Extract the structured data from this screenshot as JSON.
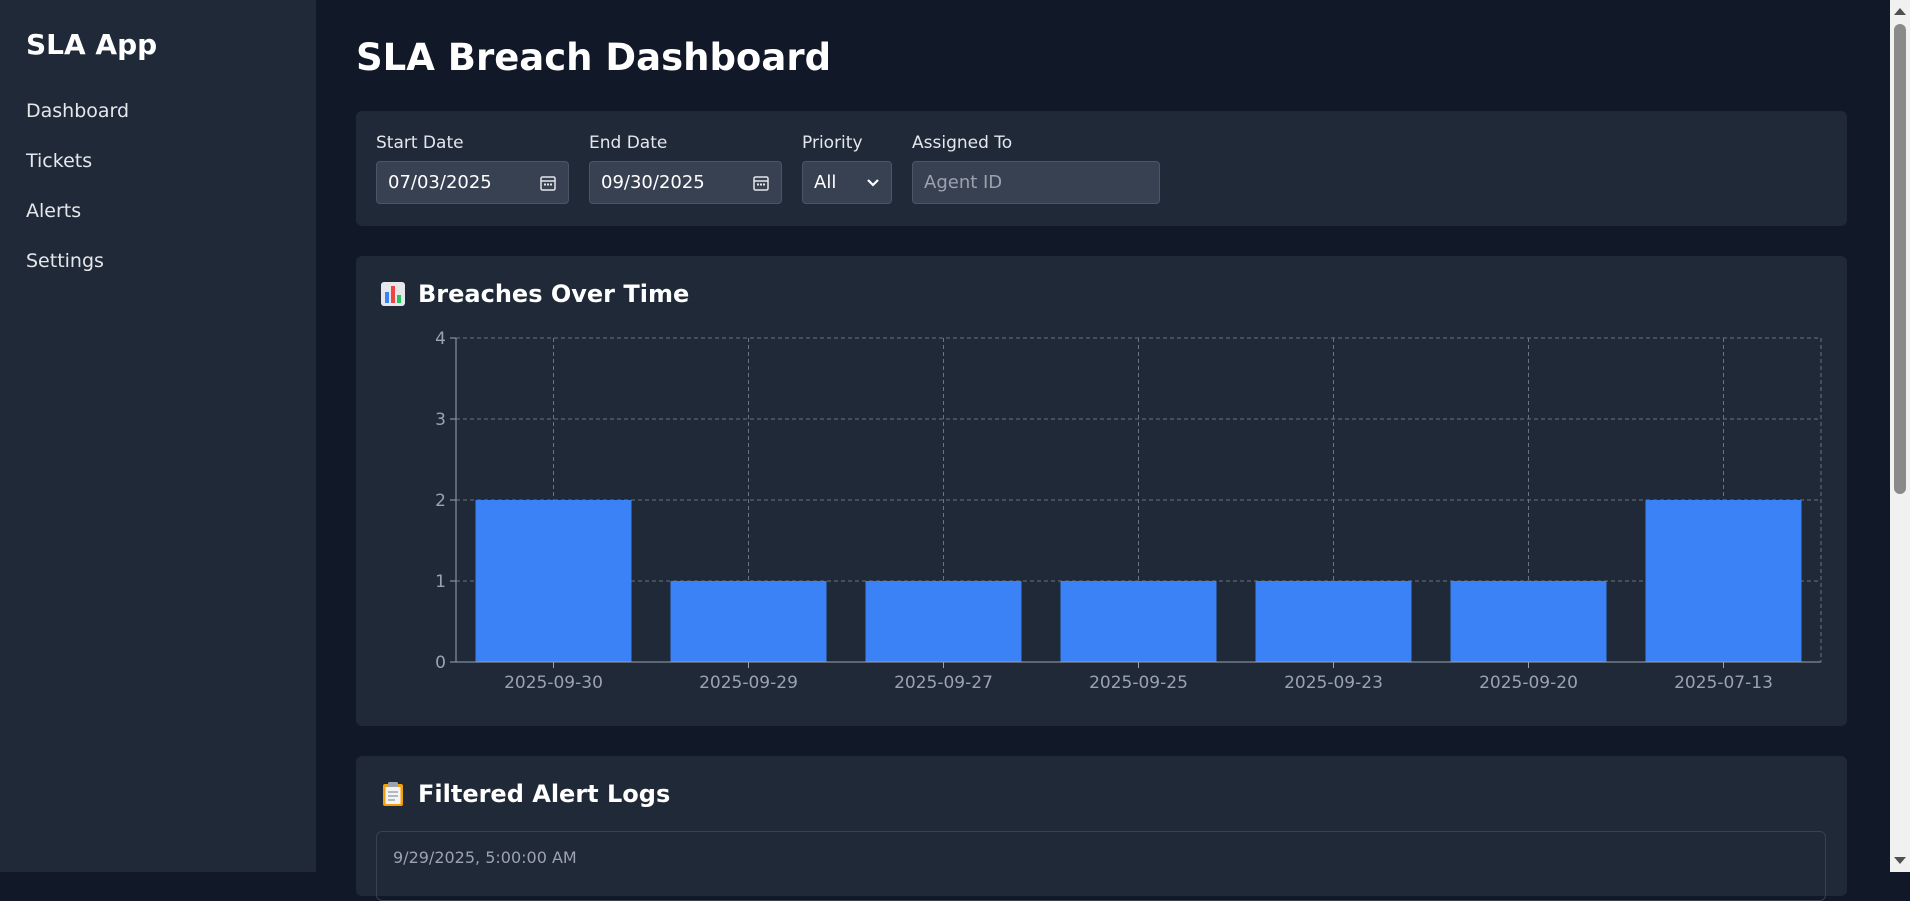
{
  "sidebar": {
    "app_title": "SLA App",
    "items": [
      {
        "label": "Dashboard"
      },
      {
        "label": "Tickets"
      },
      {
        "label": "Alerts"
      },
      {
        "label": "Settings"
      }
    ]
  },
  "page_title": "SLA Breach Dashboard",
  "filters": {
    "start_date": {
      "label": "Start Date",
      "value": "07/03/2025",
      "icon": "calendar-icon"
    },
    "end_date": {
      "label": "End Date",
      "value": "09/30/2025",
      "icon": "calendar-icon"
    },
    "priority": {
      "label": "Priority",
      "value": "All",
      "icon": "chevron-down-icon"
    },
    "assigned_to": {
      "label": "Assigned To",
      "placeholder": "Agent ID"
    }
  },
  "chart_section": {
    "heading": "Breaches Over Time",
    "icon": "bar-chart-icon"
  },
  "chart_data": {
    "type": "bar",
    "categories": [
      "2025-09-30",
      "2025-09-29",
      "2025-09-27",
      "2025-09-25",
      "2025-09-23",
      "2025-09-20",
      "2025-07-13"
    ],
    "values": [
      2,
      1,
      1,
      1,
      1,
      1,
      2
    ],
    "ylim": [
      0,
      4
    ],
    "yticks": [
      0,
      1,
      2,
      3,
      4
    ],
    "grid": true,
    "bar_color": "#3b82f6",
    "grid_color": "#6b7280",
    "tick_color": "#9ca3af"
  },
  "logs_section": {
    "heading": "Filtered Alert Logs",
    "icon": "clipboard-icon",
    "entries": [
      {
        "timestamp": "9/29/2025, 5:00:00 AM"
      }
    ]
  },
  "colors": {
    "background": "#111827",
    "panel": "#1f2937",
    "accent": "#3b82f6"
  }
}
